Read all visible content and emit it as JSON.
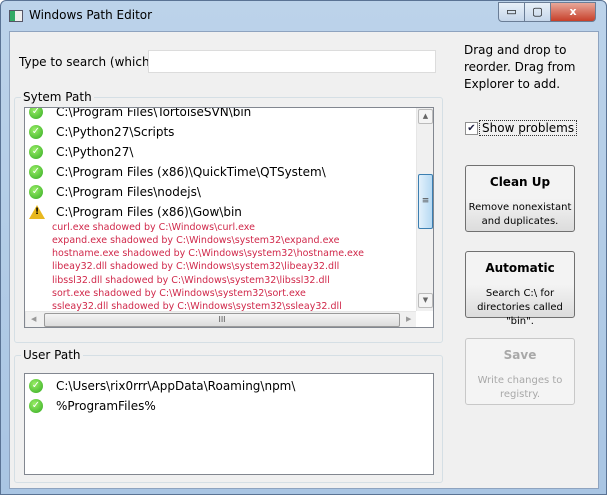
{
  "window": {
    "title": "Windows Path Editor",
    "minimize": "▭",
    "maximize": "▢",
    "close": "x"
  },
  "search": {
    "label": "Type to search (which)",
    "value": ""
  },
  "help_text": [
    "Drag and drop to",
    "reorder. Drag from",
    "Explorer to add."
  ],
  "show_problems": {
    "label": "Show problems",
    "checked": true
  },
  "system_path": {
    "label": "Sytem Path",
    "items": [
      {
        "path": "C:\\Program Files\\TortoiseSVN\\bin",
        "status": "ok"
      },
      {
        "path": "C:\\Python27\\Scripts",
        "status": "ok"
      },
      {
        "path": "C:\\Python27\\",
        "status": "ok"
      },
      {
        "path": "C:\\Program Files (x86)\\QuickTime\\QTSystem\\",
        "status": "ok"
      },
      {
        "path": "C:\\Program Files\\nodejs\\",
        "status": "ok"
      },
      {
        "path": "C:\\Program Files (x86)\\Gow\\bin",
        "status": "warning"
      }
    ],
    "problems": [
      "curl.exe shadowed by C:\\Windows\\curl.exe",
      "expand.exe shadowed by C:\\Windows\\system32\\expand.exe",
      "hostname.exe shadowed by C:\\Windows\\system32\\hostname.exe",
      "libeay32.dll shadowed by C:\\Windows\\system32\\libeay32.dll",
      "libssl32.dll shadowed by C:\\Windows\\system32\\libssl32.dll",
      "sort.exe shadowed by C:\\Windows\\system32\\sort.exe",
      "ssleay32.dll shadowed by C:\\Windows\\system32\\ssleay32.dll"
    ]
  },
  "user_path": {
    "label": "User Path",
    "items": [
      {
        "path": "C:\\Users\\rix0rrr\\AppData\\Roaming\\npm\\",
        "status": "ok"
      },
      {
        "path": "%ProgramFiles%",
        "status": "ok"
      }
    ]
  },
  "buttons": {
    "cleanup": {
      "title": "Clean Up",
      "desc": "Remove nonexistant and duplicates."
    },
    "automatic": {
      "title": "Automatic",
      "desc": "Search C:\\ for directories called \"bin\"."
    },
    "save": {
      "title": "Save",
      "desc": "Write changes to registry.",
      "disabled": true
    }
  },
  "colors": {
    "problem": "#d0284a",
    "ok": "#3a2"
  }
}
